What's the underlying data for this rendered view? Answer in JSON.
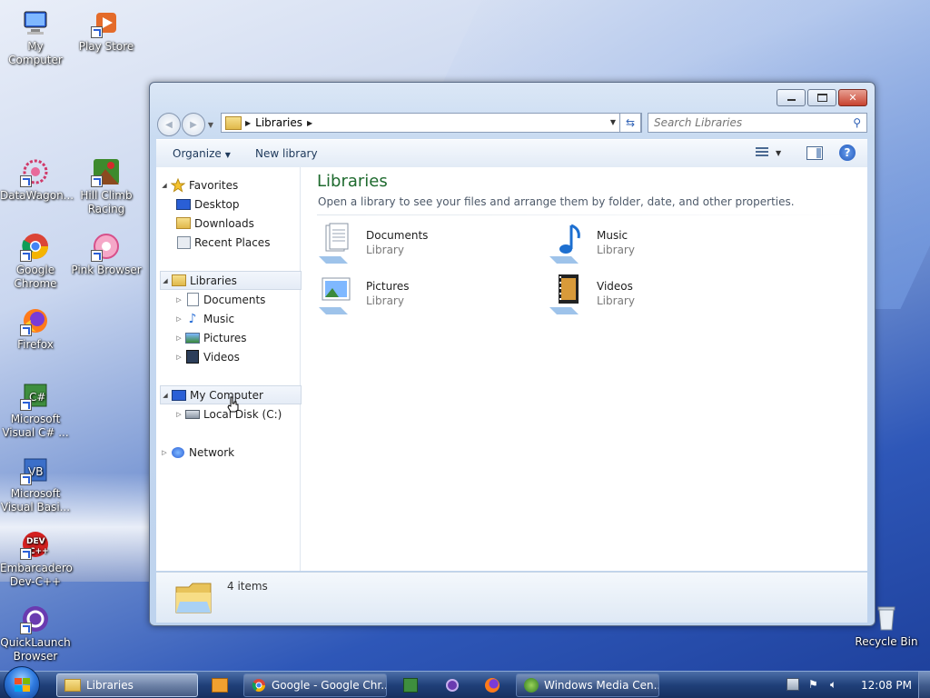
{
  "desktop": {
    "icons": [
      {
        "label": "My Computer"
      },
      {
        "label": "Play Store"
      },
      {
        "label": "DataWagon..."
      },
      {
        "label": "Hill Climb Racing"
      },
      {
        "label": "Google Chrome"
      },
      {
        "label": "Pink Browser"
      },
      {
        "label": "Firefox"
      },
      {
        "label": "Microsoft Visual C# ..."
      },
      {
        "label": "Microsoft Visual Basi..."
      },
      {
        "label": "Embarcadero Dev-C++"
      },
      {
        "label": "QuickLaunch Browser"
      },
      {
        "label": "Recycle Bin"
      }
    ]
  },
  "window": {
    "address": {
      "crumb": "Libraries"
    },
    "search": {
      "placeholder": "Search Libraries"
    },
    "toolbar": {
      "organize": "Organize",
      "new_library": "New library"
    },
    "navpane": {
      "favorites": "Favorites",
      "favorite_items": [
        "Desktop",
        "Downloads",
        "Recent Places"
      ],
      "libraries": "Libraries",
      "library_items": [
        "Documents",
        "Music",
        "Pictures",
        "Videos"
      ],
      "computer": "My Computer",
      "computer_items": [
        "Local Disk (C:)"
      ],
      "network": "Network"
    },
    "main": {
      "title": "Libraries",
      "description": "Open a library to see your files and arrange them by folder, date, and other properties.",
      "libraries": [
        {
          "name": "Documents",
          "type": "Library"
        },
        {
          "name": "Music",
          "type": "Library"
        },
        {
          "name": "Pictures",
          "type": "Library"
        },
        {
          "name": "Videos",
          "type": "Library"
        }
      ]
    },
    "details": {
      "count": "4 items"
    }
  },
  "taskbar": {
    "buttons": [
      {
        "label": "Libraries"
      },
      {
        "label": "Google - Google Chr..."
      },
      {
        "label": "Windows Media Cen..."
      }
    ],
    "clock": "12:08 PM"
  },
  "colors": {
    "title_green": "#1e6a2e",
    "taskbar": "#1f3f78"
  }
}
